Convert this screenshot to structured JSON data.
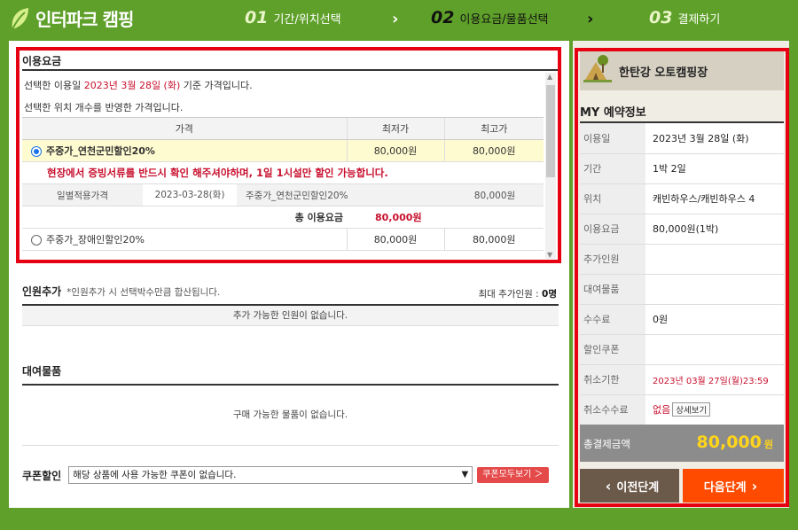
{
  "brand": {
    "name": "인터파크 캠핑"
  },
  "steps": [
    {
      "num": "01",
      "label": "기간/위치선택"
    },
    {
      "num": "02",
      "label": "이용요금/물품선택"
    },
    {
      "num": "03",
      "label": "결제하기"
    }
  ],
  "fee": {
    "title": "이용요금",
    "note_prefix": "선택한 이용일",
    "note_date": "2023년 3월 28일 (화)",
    "note_suffix": "기준 가격입니다.",
    "note2": "선택한 위치 개수를 반영한 가격입니다.",
    "headers": [
      "가격",
      "최저가",
      "최고가"
    ],
    "rows": [
      {
        "name": "주중가_연천군민할인20%",
        "min": "80,000원",
        "max": "80,000원",
        "selected": true
      },
      {
        "name": "주중가_장애인할인20%",
        "min": "80,000원",
        "max": "80,000원",
        "selected": false
      }
    ],
    "warning": "현장에서 증빙서류를 반드시 확인 해주셔야하며, 1일 1시설만 할인 가능합니다.",
    "daily": {
      "label": "일별적용가격",
      "date": "2023-03-28(화)",
      "name": "주중가_연천군민할인20%",
      "price": "80,000원"
    },
    "total_label": "총 이용요금",
    "total_value": "80,000원"
  },
  "person": {
    "title": "인원추가",
    "sub": "*인원추가 시 선택박수만큼 합산됩니다.",
    "max_label": "최대 추가인원 :",
    "max_value": "0명",
    "empty": "추가 가능한 인원이 없습니다."
  },
  "rental": {
    "title": "대여물품",
    "empty": "구매 가능한 물품이 없습니다."
  },
  "coupon": {
    "title": "쿠폰할인",
    "select_value": "해당 상품에 사용 가능한 쿠폰이 없습니다.",
    "button": "쿠폰모두보기 ＞"
  },
  "summary": {
    "camp_name": "한탄강 오토캠핑장",
    "my_title": "MY 예약정보",
    "items": [
      {
        "k": "이용일",
        "v": "2023년 3월 28일 (화)"
      },
      {
        "k": "기간",
        "v": "1박 2일"
      },
      {
        "k": "위치",
        "v": "캐빈하우스/캐빈하우스 4"
      },
      {
        "k": "이용요금",
        "v": "80,000원(1박)"
      },
      {
        "k": "추가인원",
        "v": ""
      },
      {
        "k": "대여물품",
        "v": ""
      },
      {
        "k": "수수료",
        "v": "0원"
      },
      {
        "k": "할인쿠폰",
        "v": ""
      },
      {
        "k": "취소기한",
        "v": "2023년 03월 27일(월)23:59"
      },
      {
        "k": "취소수수료",
        "v": "없음"
      }
    ],
    "detail_btn": "상세보기",
    "total_label": "총결제금액",
    "total_value": "80,000",
    "total_unit": "원"
  },
  "nav": {
    "prev": "이전단계",
    "next": "다음단계"
  },
  "colors": {
    "green": "#5fa02a",
    "red": "#e60012",
    "orange": "#ff4b00",
    "yellow": "#ffd51a"
  }
}
